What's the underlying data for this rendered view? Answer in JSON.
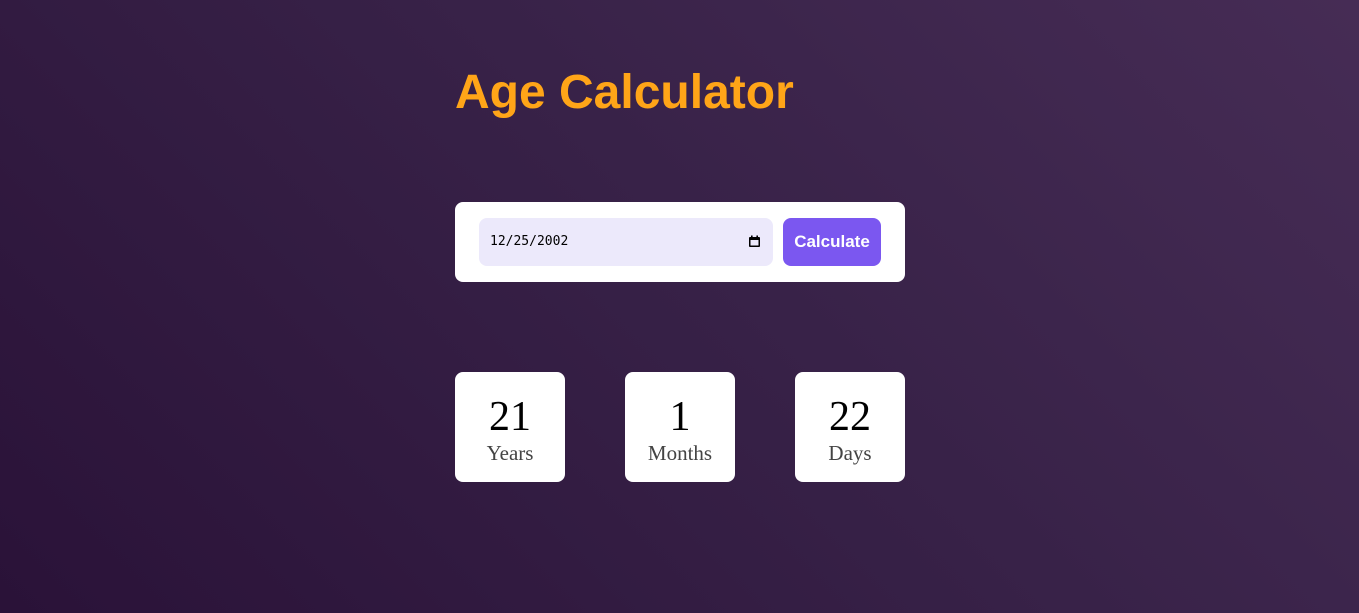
{
  "title": "Age Calculator",
  "colors": {
    "title": "#ffa518",
    "button": "#7b57f0",
    "input_bg": "#ece9fb",
    "background_start": "#2a1238",
    "background_end": "#462c55"
  },
  "form": {
    "date_value": "12/25/2002",
    "date_icon": "calendar-icon",
    "button_label": "Calculate"
  },
  "results": [
    {
      "value": "21",
      "label": "Years"
    },
    {
      "value": "1",
      "label": "Months"
    },
    {
      "value": "22",
      "label": "Days"
    }
  ]
}
